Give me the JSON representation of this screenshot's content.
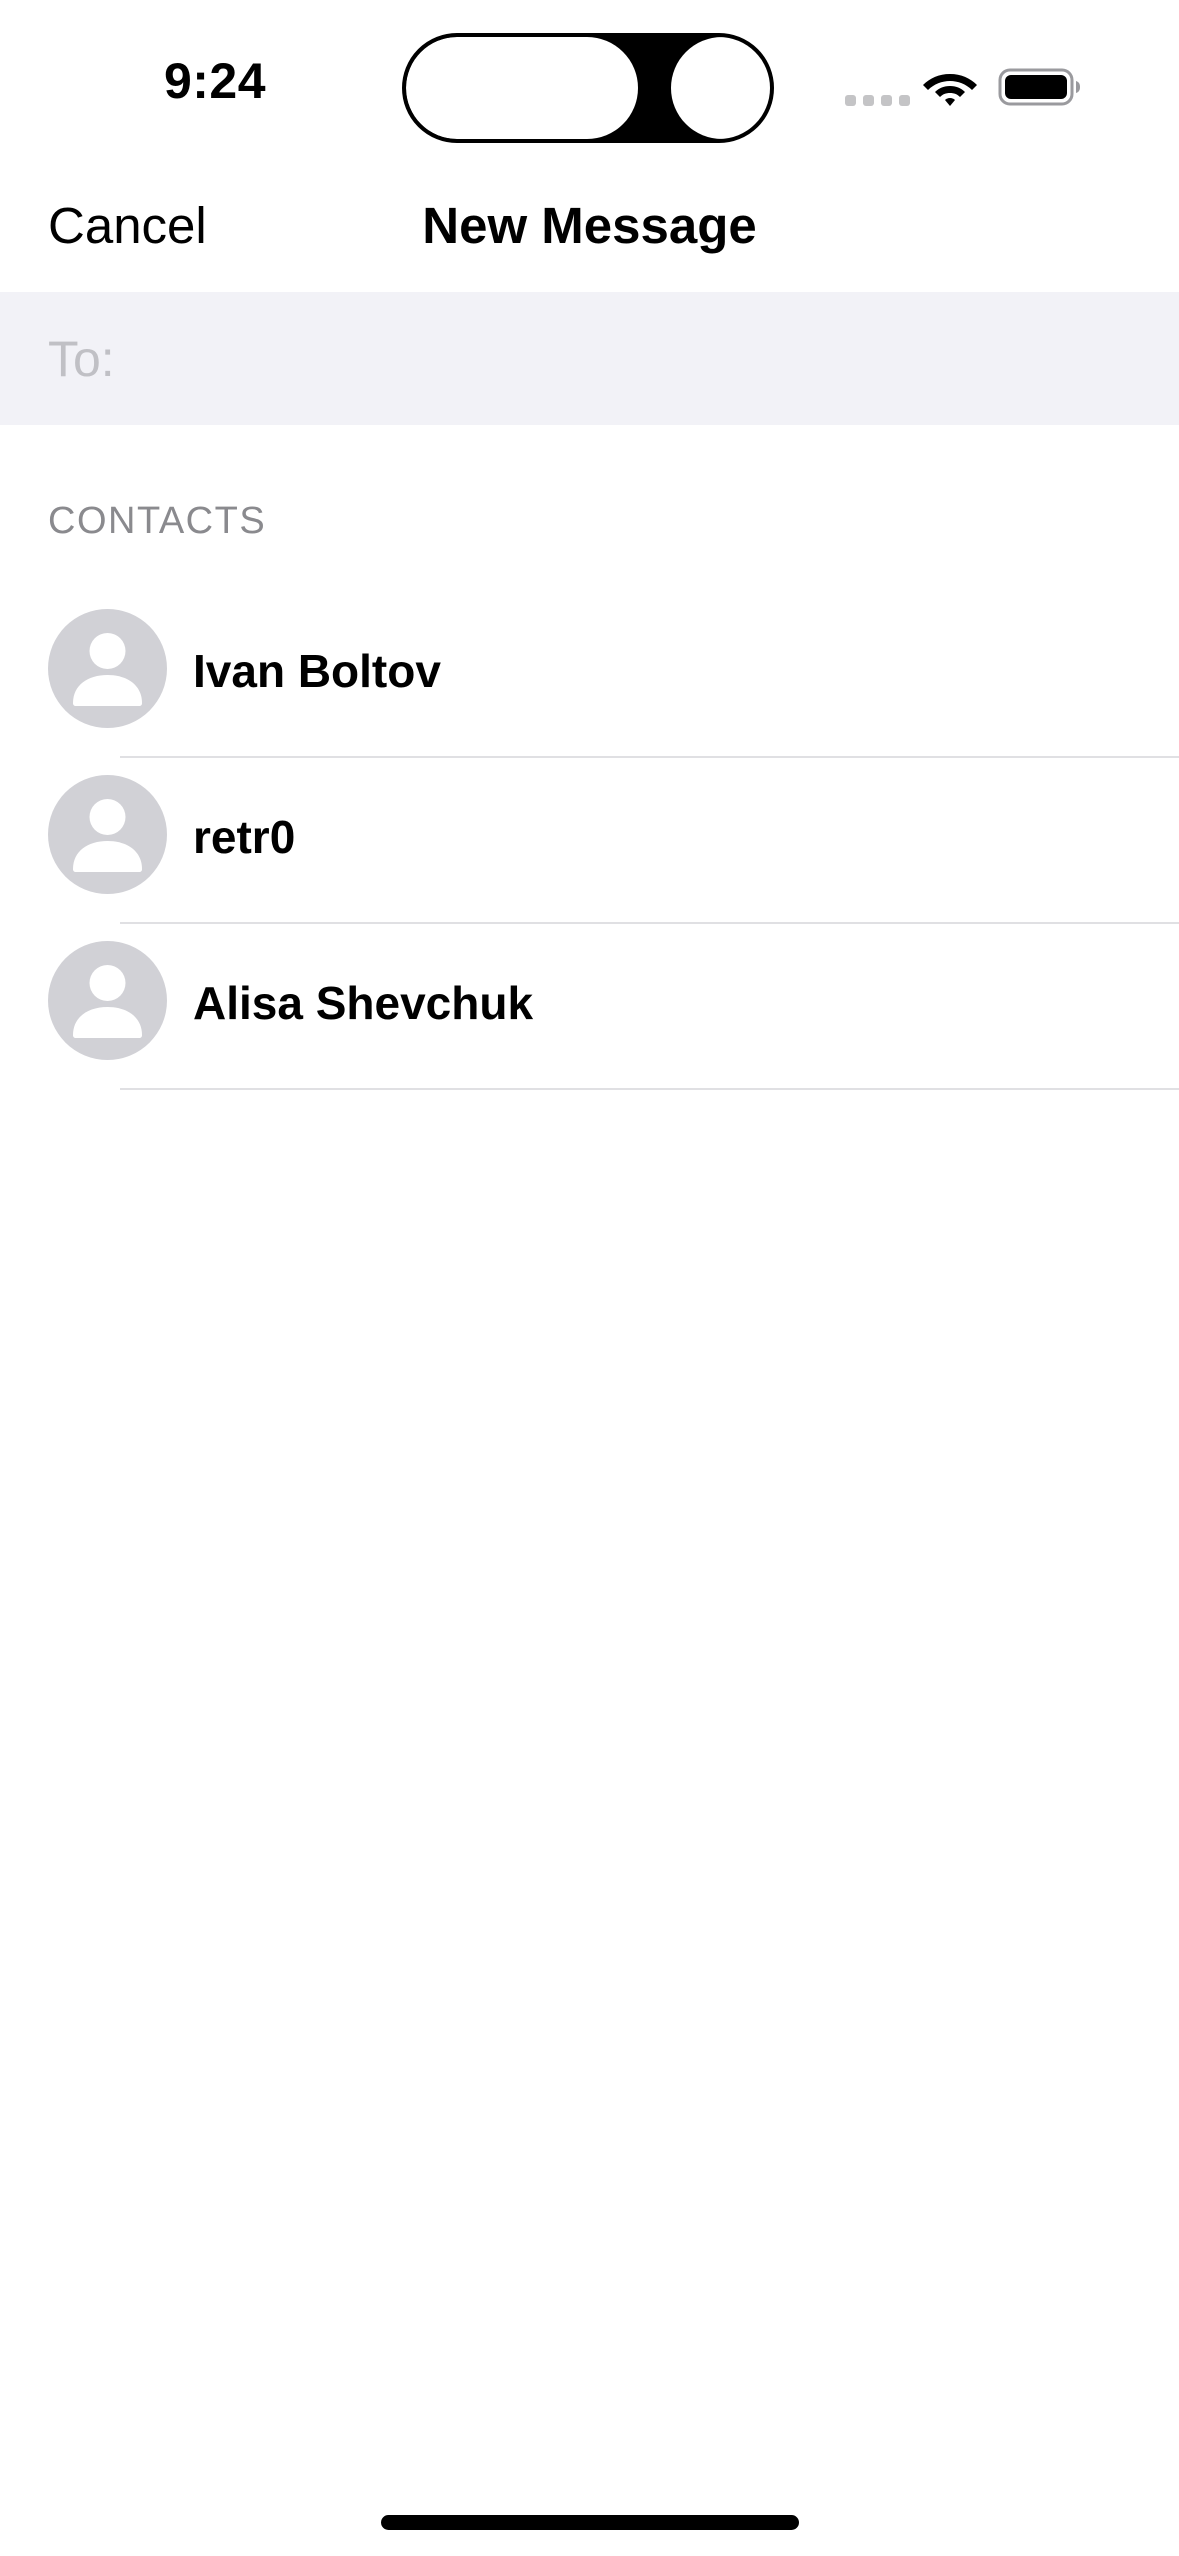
{
  "status_bar": {
    "time": "9:24",
    "icons": [
      "cellular-signal-icon",
      "wifi-icon",
      "battery-icon"
    ]
  },
  "nav": {
    "cancel_label": "Cancel",
    "title": "New Message"
  },
  "to_field": {
    "label": "To:",
    "value": ""
  },
  "contacts": {
    "section_title": "CONTACTS",
    "items": [
      {
        "name": "Ivan Boltov"
      },
      {
        "name": "retr0"
      },
      {
        "name": "Alisa Shevchuk"
      }
    ]
  },
  "colors": {
    "background": "#ffffff",
    "to_field_background": "#f2f2f7",
    "placeholder_text": "#c0c0c5",
    "section_header_text": "#8a8a8e",
    "avatar_background": "#d1d1d6",
    "divider": "#e0e0e3"
  }
}
